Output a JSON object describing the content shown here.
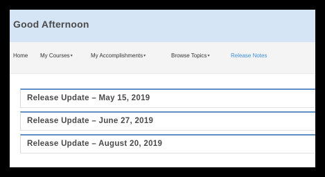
{
  "header": {
    "title": "Good Afternoon"
  },
  "nav": {
    "home": "Home",
    "my_courses": "My Courses",
    "my_accomplishments": "My Accomplishments",
    "browse_topics": "Browse Topics",
    "release_notes": "Release Notes",
    "dropdown_caret": "▾"
  },
  "release_updates": [
    {
      "label": "Release Update – May 15, 2019"
    },
    {
      "label": "Release Update – June 27, 2019"
    },
    {
      "label": "Release Update – August 20, 2019"
    }
  ],
  "colors": {
    "header_bg": "#d6e5f6",
    "accent": "#3d8fe0",
    "item_border": "#5f8fc2",
    "text": "#4a4a4a"
  }
}
